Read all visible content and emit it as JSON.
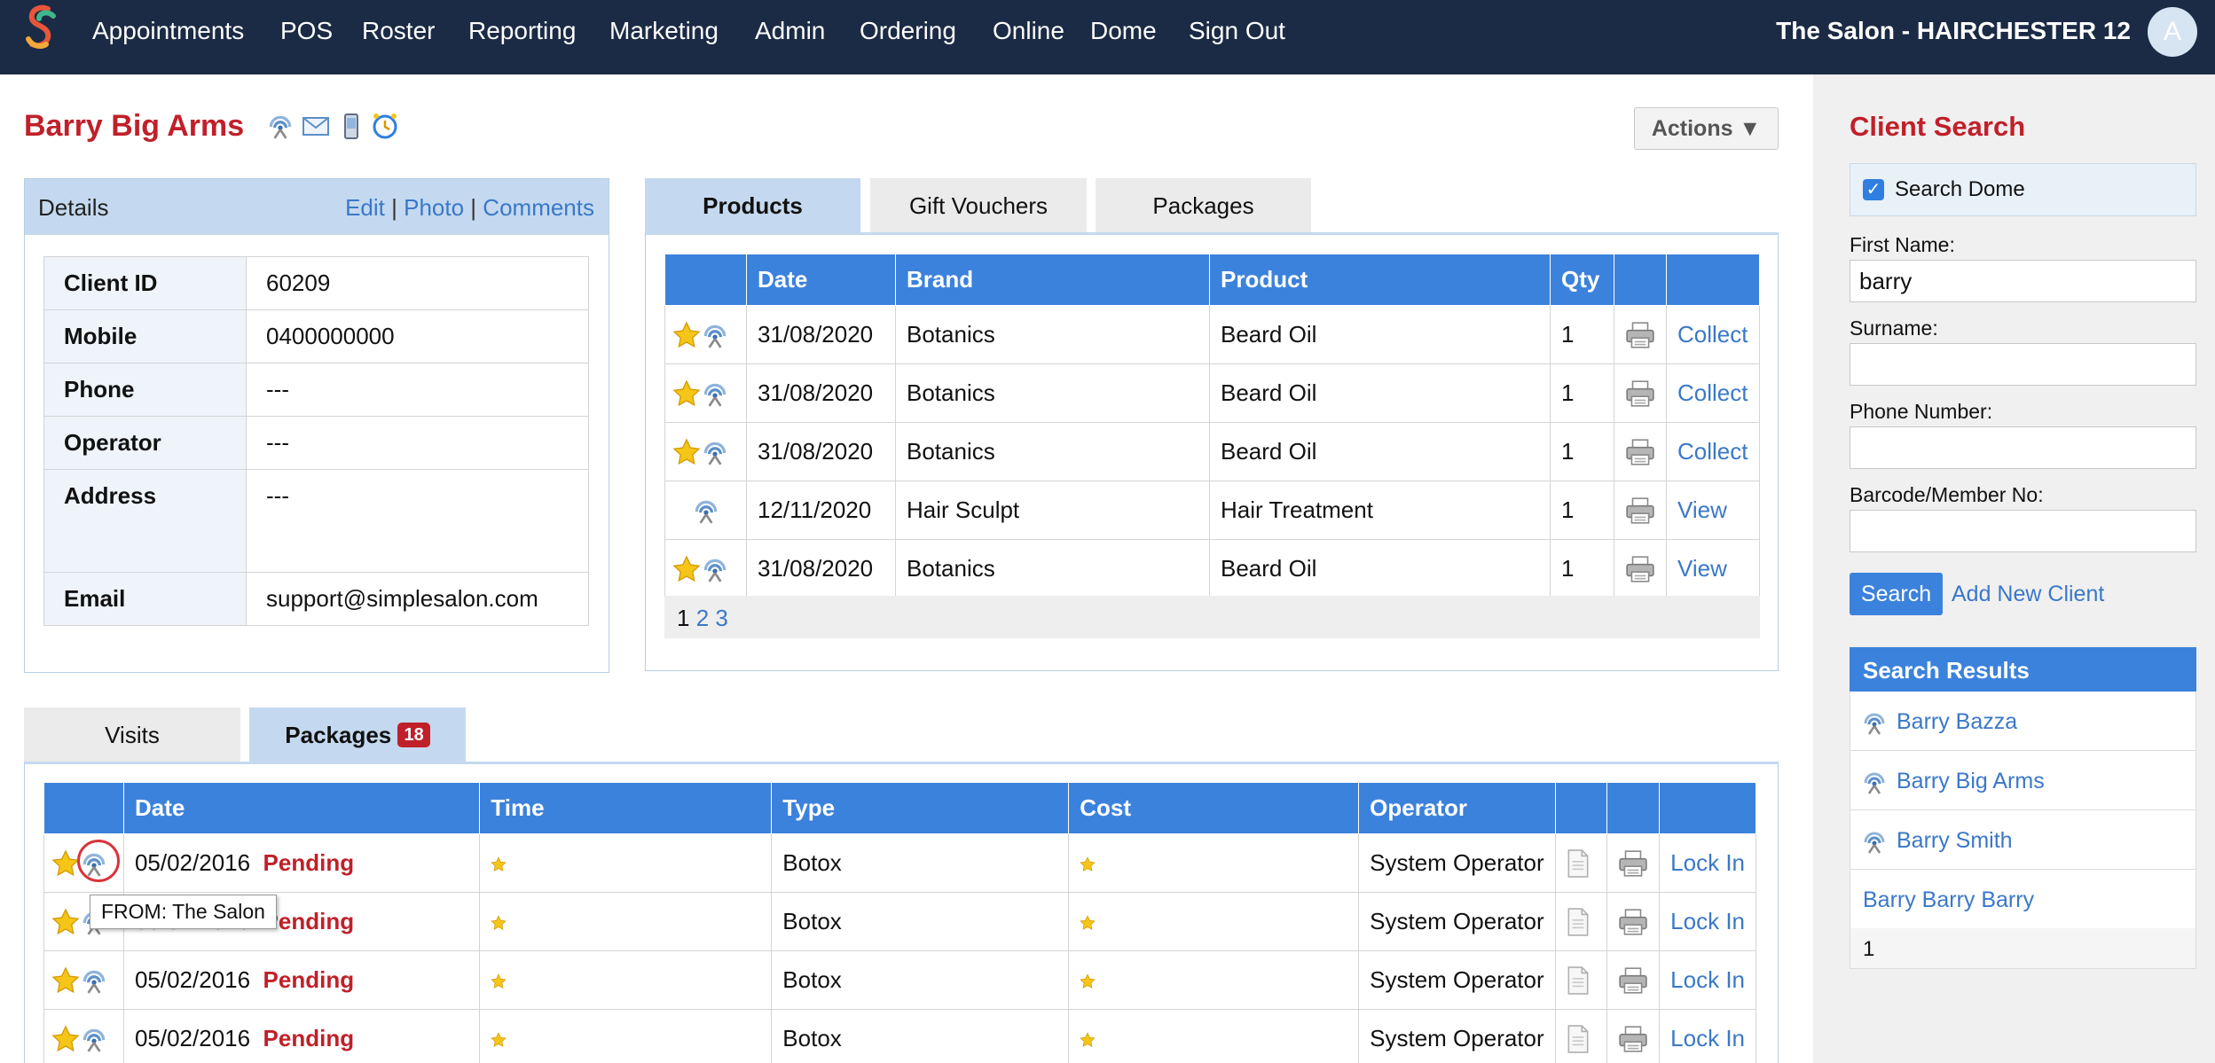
{
  "nav": {
    "items": [
      "Appointments",
      "POS",
      "Roster",
      "Reporting",
      "Marketing",
      "Admin",
      "Ordering",
      "Online",
      "Dome",
      "Sign Out"
    ],
    "salon": "The Salon - HAIRCHESTER 12",
    "avatar": "A"
  },
  "client": {
    "name": "Barry Big Arms",
    "icons": [
      "dome-icon",
      "email-icon",
      "mobile-icon",
      "alarm-clock-icon"
    ],
    "actions_label": "Actions ▼"
  },
  "details": {
    "title": "Details",
    "edit": "Edit",
    "sep": "|",
    "photo": "Photo",
    "comments": "Comments",
    "rows": [
      {
        "label": "Client ID",
        "value": "60209"
      },
      {
        "label": "Mobile",
        "value": "0400000000"
      },
      {
        "label": "Phone",
        "value": "---"
      },
      {
        "label": "Operator",
        "value": "---"
      },
      {
        "label": "Address",
        "value": "---"
      },
      {
        "label": "Email",
        "value": "support@simplesalon.com"
      }
    ]
  },
  "products": {
    "tabs": [
      "Products",
      "Gift Vouchers",
      "Packages"
    ],
    "columns": [
      "",
      "Date",
      "Brand",
      "Product",
      "Qty",
      "",
      ""
    ],
    "rows": [
      {
        "star": true,
        "date": "31/08/2020",
        "brand": "Botanics",
        "product": "Beard Oil",
        "qty": "1",
        "action": "Collect"
      },
      {
        "star": true,
        "date": "31/08/2020",
        "brand": "Botanics",
        "product": "Beard Oil",
        "qty": "1",
        "action": "Collect"
      },
      {
        "star": true,
        "date": "31/08/2020",
        "brand": "Botanics",
        "product": "Beard Oil",
        "qty": "1",
        "action": "Collect"
      },
      {
        "star": false,
        "date": "12/11/2020",
        "brand": "Hair Sculpt",
        "product": "Hair Treatment",
        "qty": "1",
        "action": "View"
      },
      {
        "star": true,
        "date": "31/08/2020",
        "brand": "Botanics",
        "product": "Beard Oil",
        "qty": "1",
        "action": "View"
      }
    ],
    "pages": [
      "1",
      "2",
      "3"
    ]
  },
  "bottom": {
    "tabs": [
      "Visits",
      "Packages"
    ],
    "packages_badge": "18",
    "columns": [
      "",
      "Date",
      "Time",
      "Type",
      "Cost",
      "Operator",
      "",
      "",
      ""
    ],
    "rows": [
      {
        "date": "05/02/2016",
        "status": "Pending",
        "type": "Botox",
        "operator": "System Operator",
        "action": "Lock In"
      },
      {
        "date": "05/02/2016",
        "status": "Pending",
        "type": "Botox",
        "operator": "System Operator",
        "action": "Lock In"
      },
      {
        "date": "05/02/2016",
        "status": "Pending",
        "type": "Botox",
        "operator": "System Operator",
        "action": "Lock In"
      },
      {
        "date": "05/02/2016",
        "status": "Pending",
        "type": "Botox",
        "operator": "System Operator",
        "action": "Lock In"
      }
    ],
    "tooltip": "FROM: The Salon"
  },
  "search": {
    "title": "Client Search",
    "dome_label": "Search Dome",
    "dome_checked": true,
    "first_name_label": "First Name:",
    "first_name_value": "barry",
    "surname_label": "Surname:",
    "surname_value": "",
    "phone_label": "Phone Number:",
    "phone_value": "",
    "barcode_label": "Barcode/Member No:",
    "barcode_value": "",
    "search_button": "Search",
    "add_new": "Add New Client",
    "results_title": "Search Results",
    "results": [
      {
        "name": "Barry Bazza",
        "dome": true
      },
      {
        "name": "Barry Big Arms",
        "dome": true
      },
      {
        "name": "Barry Smith",
        "dome": true
      },
      {
        "name": "Barry Barry Barry",
        "dome": false
      }
    ],
    "results_page": "1"
  },
  "colors": {
    "nav_bg": "#1b2b45",
    "accent_blue": "#3b82dc",
    "link_blue": "#3a78c9",
    "brand_red": "#c0202a",
    "panel_head": "#c4d9ef"
  }
}
